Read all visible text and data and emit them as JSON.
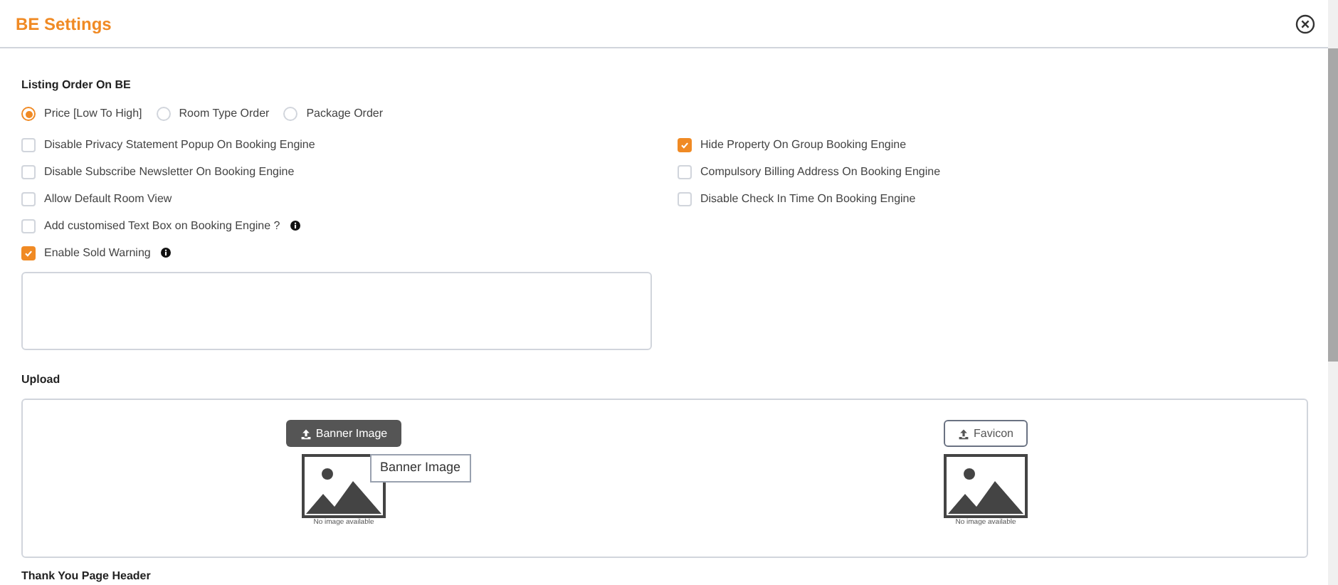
{
  "dialog": {
    "title": "BE Settings"
  },
  "listing_order": {
    "label": "Listing Order On BE",
    "options": [
      {
        "label": "Price [Low To High]",
        "selected": true
      },
      {
        "label": "Room Type Order",
        "selected": false
      },
      {
        "label": "Package Order",
        "selected": false
      }
    ]
  },
  "options_left": [
    {
      "label": "Disable Privacy Statement Popup On Booking Engine",
      "checked": false,
      "info": false
    },
    {
      "label": "Disable Subscribe Newsletter On Booking Engine",
      "checked": false,
      "info": false
    },
    {
      "label": "Allow Default Room View",
      "checked": false,
      "info": false
    },
    {
      "label": "Add customised Text Box on Booking Engine ?",
      "checked": false,
      "info": true
    },
    {
      "label": "Enable Sold Warning",
      "checked": true,
      "info": true
    }
  ],
  "options_right": [
    {
      "label": "Hide Property On Group Booking Engine",
      "checked": true,
      "info": false
    },
    {
      "label": "Compulsory Billing Address On Booking Engine",
      "checked": false,
      "info": false
    },
    {
      "label": "Disable Check In Time On Booking Engine",
      "checked": false,
      "info": false
    }
  ],
  "upload": {
    "label": "Upload",
    "items": [
      {
        "button": "Banner Image",
        "kind": "dark",
        "caption": "No image available",
        "tooltip": "Banner Image"
      },
      {
        "button": "Favicon",
        "kind": "outline",
        "caption": "No image available"
      }
    ]
  },
  "next_section": {
    "label": "Thank You Page Header"
  }
}
